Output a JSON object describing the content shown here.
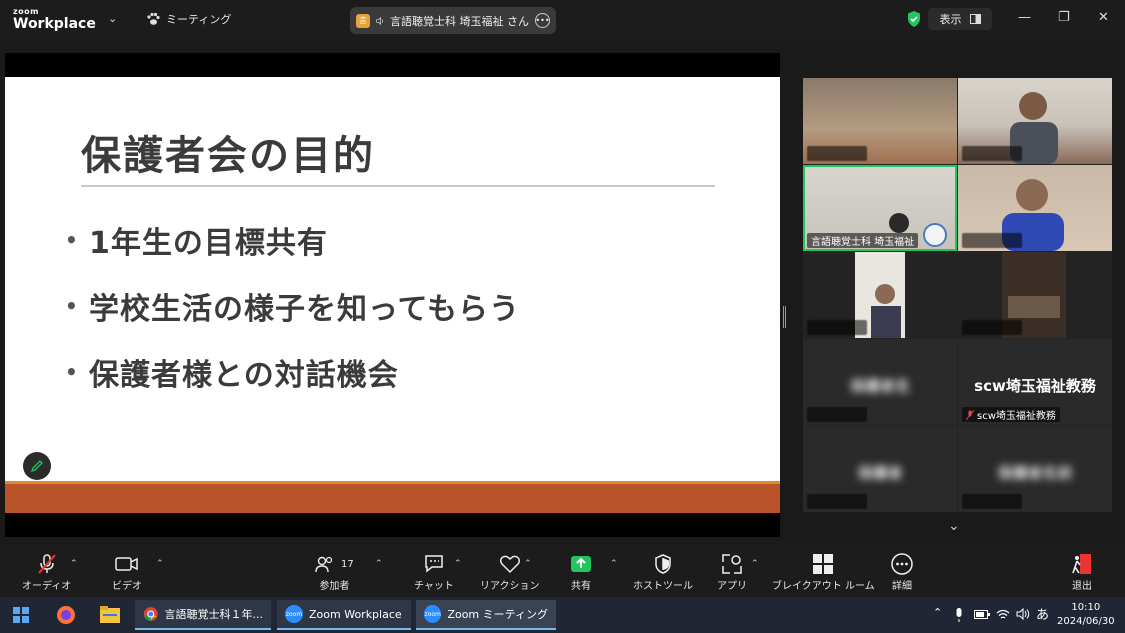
{
  "titlebar": {
    "logo_small": "zoom",
    "logo_big": "Workplace",
    "meeting_menu_label": "ミーティング",
    "speaker_label": "言語聴覚士科 埼玉福祉 さん",
    "speaker_badge": "言",
    "view_label": "表示"
  },
  "slide": {
    "title": "保護者会の目的",
    "bullets": [
      "1年生の目標共有",
      "学校生活の様子を知ってもらう",
      "保護者様との対話機会"
    ]
  },
  "gallery": {
    "tiles": [
      {
        "name": "",
        "blurred": true
      },
      {
        "name": "",
        "blurred": true
      },
      {
        "name": "言語聴覚士科 埼玉福祉",
        "blurred": false
      },
      {
        "name": "",
        "blurred": true
      },
      {
        "name": "",
        "blurred": true
      },
      {
        "name": "",
        "blurred": true
      },
      {
        "name": "",
        "blurred": true
      },
      {
        "name": "scw埼玉福祉教務",
        "blurred": false
      },
      {
        "name": "",
        "blurred": true
      },
      {
        "name": "",
        "blurred": true
      }
    ],
    "big_name_scw": "scw埼玉福祉教務"
  },
  "toolbar": {
    "audio": "オーディオ",
    "video": "ビデオ",
    "participants": "参加者",
    "participants_count": "17",
    "chat": "チャット",
    "reaction": "リアクション",
    "share": "共有",
    "host_tools": "ホストツール",
    "apps": "アプリ",
    "breakout": "ブレイクアウト ルーム",
    "more": "詳細",
    "leave": "退出"
  },
  "taskbar": {
    "chrome_label": "言語聴覚士科１年...",
    "zoom_workplace_label": "Zoom Workplace",
    "zoom_meeting_label": "Zoom ミーティング",
    "ime": "あ",
    "time": "10:10",
    "date": "2024/06/30"
  },
  "colors": {
    "accent_green": "#22c55e",
    "slide_band": "#b8532a",
    "zoom_blue": "#2d8cff"
  }
}
